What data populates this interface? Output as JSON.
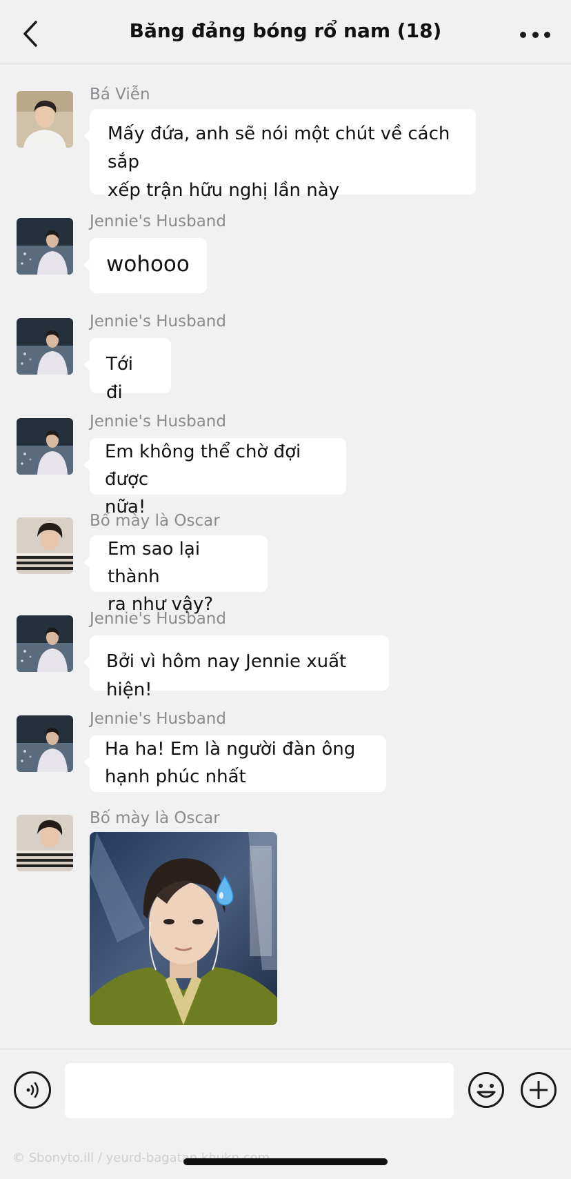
{
  "header": {
    "title": "Băng đảng bóng rổ nam (18)",
    "back_icon": "chevron-left-icon",
    "more_icon": "more-horizontal-icon"
  },
  "messages": [
    {
      "sender": "Bá Viễn",
      "text_lines": [
        "Mấy đứa, anh sẽ nói một chút về cách sắp",
        "xếp trận hữu nghị lần này"
      ]
    },
    {
      "sender": "Jennie's Husband",
      "text_lines": [
        "wohooo"
      ]
    },
    {
      "sender": "Jennie's Husband",
      "text_lines": [
        "Tới đi"
      ]
    },
    {
      "sender": "Jennie's Husband",
      "text_lines": [
        "Em không thể chờ đợi được",
        "nữa!"
      ]
    },
    {
      "sender": "Bố mày là Oscar",
      "text_lines": [
        "Em sao lại thành",
        "ra như vậy?"
      ]
    },
    {
      "sender": "Jennie's Husband",
      "text_lines": [
        "Bởi vì hôm nay Jennie xuất hiện!"
      ]
    },
    {
      "sender": "Jennie's Husband",
      "text_lines": [
        "Ha ha! Em là người đàn ông",
        "hạnh phúc nhất"
      ]
    },
    {
      "sender": "Bố mày là Oscar",
      "image": "sweat-drop-reaction-photo"
    }
  ],
  "input_bar": {
    "voice_icon": "voice-icon",
    "emoji_icon": "smiley-icon",
    "plus_icon": "plus-circle-icon",
    "placeholder": ""
  },
  "watermark": "© Sbonyto.ill / yeurd-bagatan khukn.com",
  "colors": {
    "background": "#f1f1f2",
    "bubble": "#ffffff",
    "sender_text": "#8b8b8f",
    "jacket_green": "#6f7d22"
  }
}
